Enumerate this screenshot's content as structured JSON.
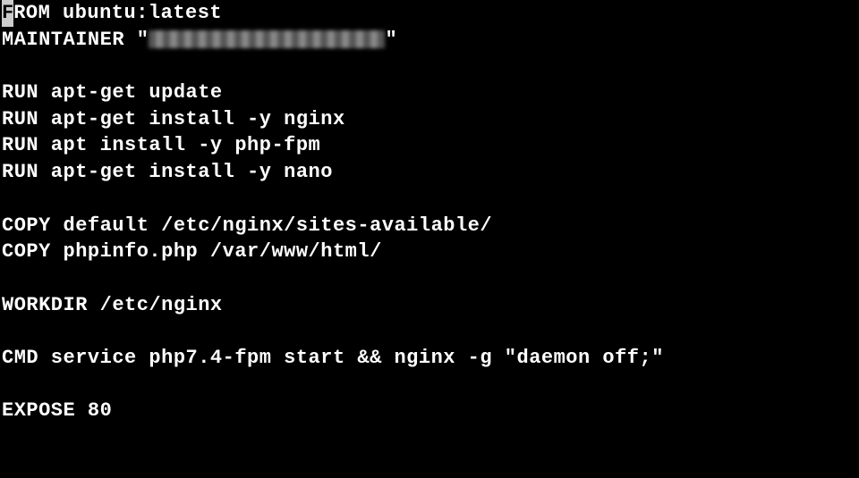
{
  "file": {
    "lines": [
      {
        "type": "cursor_text",
        "cursor": "F",
        "rest": "ROM ubuntu:latest"
      },
      {
        "type": "masked",
        "prefix": "MAINTAINER \"",
        "suffix": "\""
      },
      {
        "type": "blank"
      },
      {
        "type": "text",
        "text": "RUN apt-get update"
      },
      {
        "type": "text",
        "text": "RUN apt-get install -y nginx"
      },
      {
        "type": "text",
        "text": "RUN apt install -y php-fpm"
      },
      {
        "type": "text",
        "text": "RUN apt-get install -y nano"
      },
      {
        "type": "blank"
      },
      {
        "type": "text",
        "text": "COPY default /etc/nginx/sites-available/"
      },
      {
        "type": "text",
        "text": "COPY phpinfo.php /var/www/html/"
      },
      {
        "type": "blank"
      },
      {
        "type": "text",
        "text": "WORKDIR /etc/nginx"
      },
      {
        "type": "blank"
      },
      {
        "type": "text",
        "text": "CMD service php7.4-fpm start && nginx -g \"daemon off;\""
      },
      {
        "type": "blank"
      },
      {
        "type": "text",
        "text": "EXPOSE 80"
      }
    ]
  }
}
